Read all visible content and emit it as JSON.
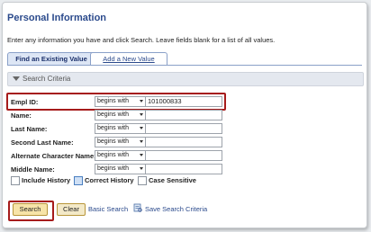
{
  "page": {
    "title": "Personal Information",
    "instructions": "Enter any information you have and click Search. Leave fields blank for a list of all values."
  },
  "tabs": [
    {
      "label": "Find an Existing Value"
    },
    {
      "label": "Add a New Value"
    }
  ],
  "section": {
    "title": "Search Criteria"
  },
  "fields": [
    {
      "label": "Empl ID:",
      "operator": "begins with",
      "value": "101000833"
    },
    {
      "label": "Name:",
      "operator": "begins with",
      "value": ""
    },
    {
      "label": "Last Name:",
      "operator": "begins with",
      "value": ""
    },
    {
      "label": "Second Last Name:",
      "operator": "begins with",
      "value": ""
    },
    {
      "label": "Alternate Character Name:",
      "operator": "begins with",
      "value": ""
    },
    {
      "label": "Middle Name:",
      "operator": "begins with",
      "value": ""
    }
  ],
  "checkboxes": [
    {
      "label": "Include History",
      "checked": false
    },
    {
      "label": "Correct History",
      "checked": false
    },
    {
      "label": "Case Sensitive",
      "checked": false
    }
  ],
  "buttons": {
    "search": "Search",
    "clear": "Clear"
  },
  "links": {
    "basic_search": "Basic Search",
    "save_search": "Save Search Criteria"
  }
}
